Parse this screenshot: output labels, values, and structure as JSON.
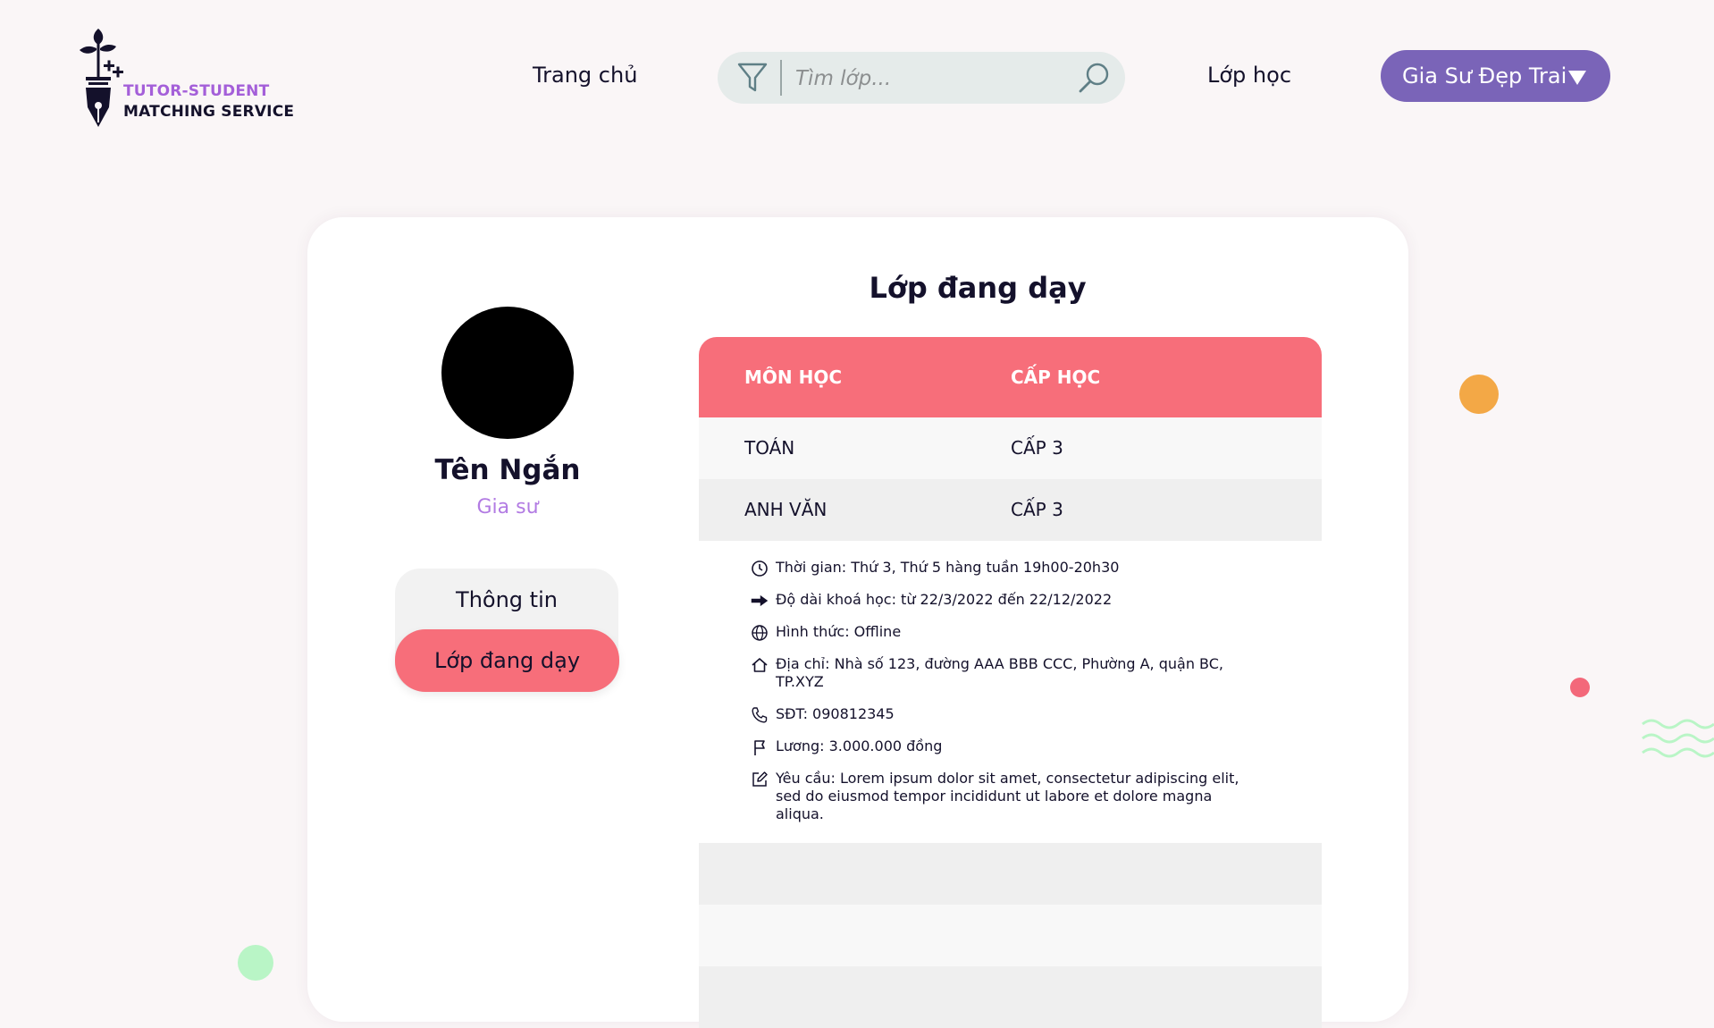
{
  "header": {
    "logo_line1": "TUTOR-STUDENT",
    "logo_line2": "MATCHING SERVICE",
    "nav_home": "Trang chủ",
    "search_placeholder": "Tìm lớp...",
    "nav_classes": "Lớp học",
    "user_menu_label": "Gia Sư Đẹp Trai"
  },
  "profile": {
    "name": "Tên Ngắn",
    "role": "Gia sư"
  },
  "side_menu": {
    "items": [
      {
        "label": "Thông tin"
      },
      {
        "label": "Lớp đang dạy"
      }
    ]
  },
  "main": {
    "title": "Lớp đang dạy",
    "table": {
      "headers": [
        "MÔN HỌC",
        "CẤP HỌC"
      ],
      "rows": [
        {
          "subject": "TOÁN",
          "level": "CẤP 3"
        },
        {
          "subject": "ANH VĂN",
          "level": "CẤP 3"
        }
      ]
    },
    "details": [
      {
        "icon": "clock-icon",
        "text": "Thời gian: Thứ 3, Thứ 5 hàng tuần 19h00-20h30"
      },
      {
        "icon": "arrow-right-icon",
        "text": "Độ dài khoá học: từ 22/3/2022 đến 22/12/2022"
      },
      {
        "icon": "globe-icon",
        "text": "Hình thức: Offline"
      },
      {
        "icon": "home-icon",
        "text": "Địa chỉ: Nhà số 123, đường AAA BBB CCC, Phường A, quận BC, TP.XYZ"
      },
      {
        "icon": "phone-icon",
        "text": "SĐT: 090812345"
      },
      {
        "icon": "flag-icon",
        "text": "Lương: 3.000.000 đồng"
      },
      {
        "icon": "edit-icon",
        "text": "Yêu cầu: Lorem ipsum dolor sit amet, consectetur adipiscing elit, sed do eiusmod tempor incididunt ut labore et dolore magna aliqua."
      }
    ]
  },
  "colors": {
    "accent_pink": "#f76e7a",
    "accent_purple": "#7a64b8",
    "brand_purple_text": "#a45fd9",
    "background": "#faf6f7"
  }
}
